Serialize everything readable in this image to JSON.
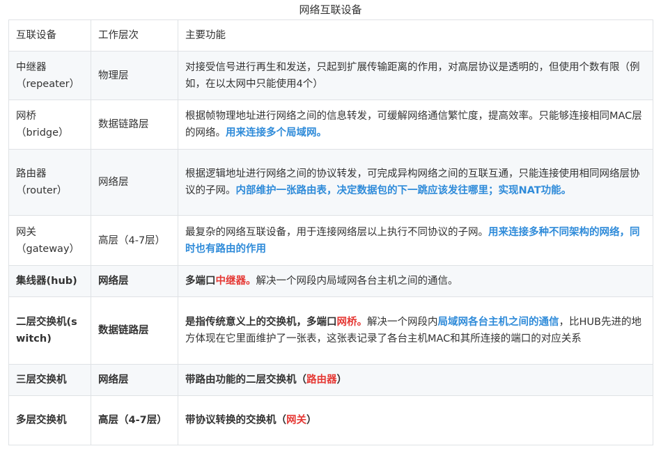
{
  "caption": "网络互联设备",
  "header": {
    "device": "互联设备",
    "layer": "工作层次",
    "function": "主要功能"
  },
  "rows": [
    {
      "device": "中继器\n（repeater）",
      "layer": "物理层",
      "segments": [
        {
          "text": "对接受信号进行再生和发送，只起到扩展传输距离的作用，对高层协议是透明的，但使用个数有限（例如，在以太网中只能使用4个）",
          "style": "normal"
        }
      ],
      "bold_row": false
    },
    {
      "device": "网桥\n（bridge）",
      "layer": "数据链路层",
      "segments": [
        {
          "text": "根据帧物理地址进行网络之间的信息转发，可缓解网络通信繁忙度，提高效率。只能够连接相同MAC层的网络。",
          "style": "normal"
        },
        {
          "text": "用来连接多个局域网。",
          "style": "blue"
        }
      ],
      "bold_row": false
    },
    {
      "device": "路由器\n（router）",
      "layer": "网络层",
      "segments": [
        {
          "text": "根据逻辑地址进行网络之间的协议转发，可完成异构网络之间的互联互通，只能连接使用相同网络层协议的子网。",
          "style": "normal"
        },
        {
          "text": "内部维护一张路由表，决定数据包的下一跳应该发往哪里；实现NAT功能。",
          "style": "blue"
        }
      ],
      "bold_row": false
    },
    {
      "device": "网关\n（gateway）",
      "layer": "高层（4-7层）",
      "segments": [
        {
          "text": "最复杂的网络互联设备，用于连接网络层以上执行不同协议的子网。",
          "style": "normal"
        },
        {
          "text": "用来连接多种不同架构的网络，同时也有路由的作用",
          "style": "blue"
        }
      ],
      "bold_row": false
    },
    {
      "device": "集线器(hub)",
      "layer": "网络层",
      "segments": [
        {
          "text": "多端口",
          "style": "bold"
        },
        {
          "text": "中继器。",
          "style": "red"
        },
        {
          "text": "解决一个网段内局域网各台主机之间的通信。",
          "style": "normal"
        }
      ],
      "bold_row": true
    },
    {
      "device": "二层交换机(switch)",
      "layer": "数据链路层",
      "segments": [
        {
          "text": "是指传统意义上的交换机，多端口",
          "style": "bold"
        },
        {
          "text": "网桥。",
          "style": "red"
        },
        {
          "text": "解决一个网段内",
          "style": "normal"
        },
        {
          "text": "局域网各台主机之间的通信",
          "style": "blue"
        },
        {
          "text": "，比HUB先进的地方体现在它里面维护了一张表，这张表记录了各台主机MAC和其所连接的端口的对应关系",
          "style": "normal"
        }
      ],
      "bold_row": true
    },
    {
      "device": "三层交换机",
      "layer": "网络层",
      "segments": [
        {
          "text": "带路由功能的二层交换机（",
          "style": "bold"
        },
        {
          "text": "路由器",
          "style": "red"
        },
        {
          "text": "）",
          "style": "bold"
        }
      ],
      "bold_row": true
    },
    {
      "device": "多层交换机",
      "layer": "高层（4-7层）",
      "segments": [
        {
          "text": "带协议转换的交换机（",
          "style": "bold"
        },
        {
          "text": "网关",
          "style": "red"
        },
        {
          "text": "）",
          "style": "bold"
        }
      ],
      "bold_row": true
    }
  ]
}
